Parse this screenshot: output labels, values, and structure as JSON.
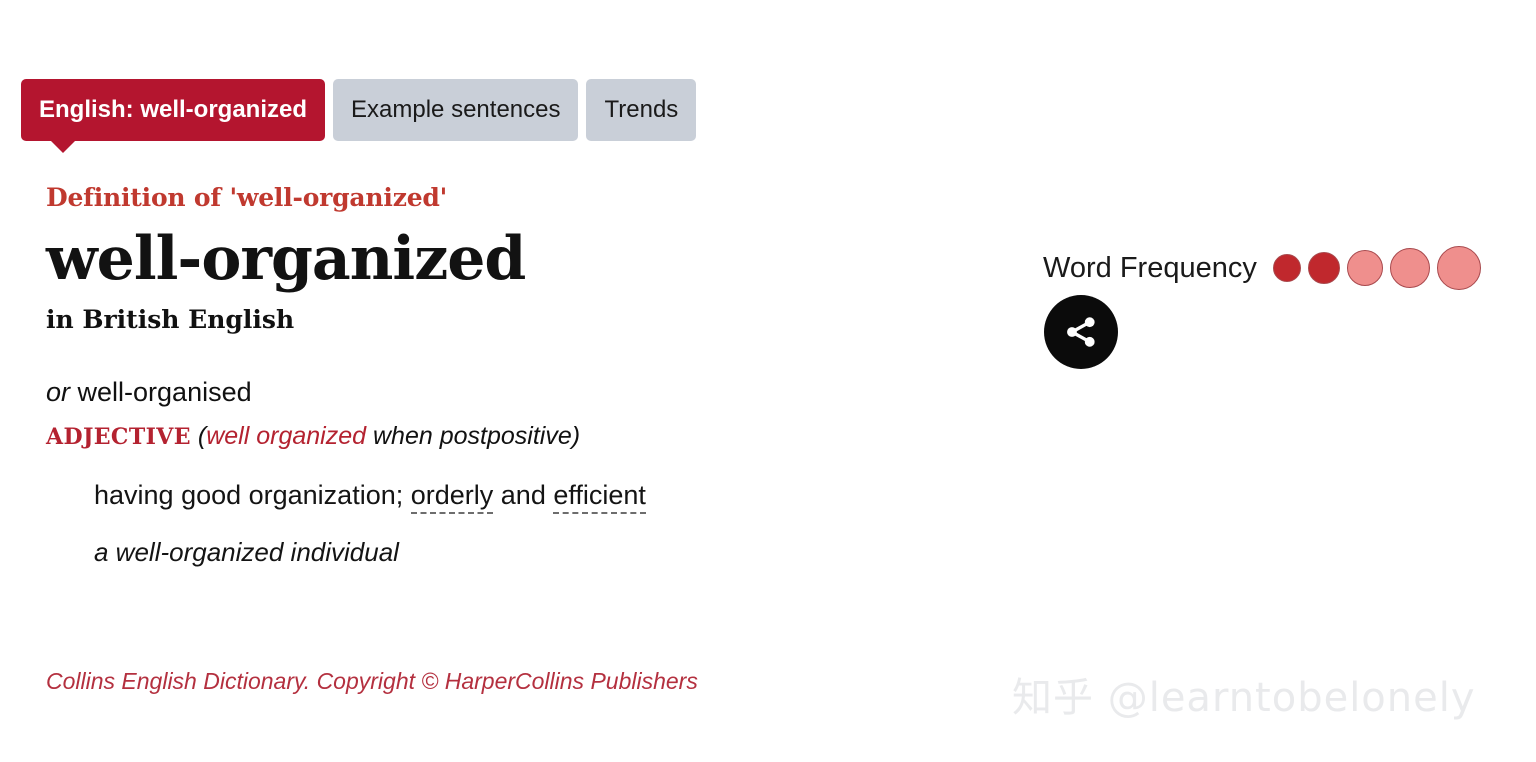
{
  "tabs": [
    {
      "label": "English: well-organized",
      "active": true
    },
    {
      "label": "Example sentences",
      "active": false
    },
    {
      "label": "Trends",
      "active": false
    }
  ],
  "definition": {
    "heading": "Definition of 'well-organized'",
    "headword": "well-organized",
    "language_label": "in British English",
    "variant_prefix": "or",
    "variant_word": "well-organised",
    "pos_tag": "ADJECTIVE",
    "pos_note_open": "(",
    "pos_note_red": "well organized",
    "pos_note_rest": " when postpositive",
    "pos_note_close": ")",
    "sense_text_before": "having good organization; ",
    "sense_link_1": "orderly",
    "sense_text_middle": " and ",
    "sense_link_2": "efficient",
    "example": "a well-organized individual",
    "copyright": "Collins English Dictionary. Copyright © HarperCollins Publishers"
  },
  "word_frequency": {
    "label": "Word Frequency",
    "rating": 2,
    "max": 5,
    "dots": [
      {
        "size": 28,
        "color": "#c0282d"
      },
      {
        "size": 32,
        "color": "#c0282d"
      },
      {
        "size": 36,
        "color": "#ef8f8d"
      },
      {
        "size": 40,
        "color": "#ef8f8d"
      },
      {
        "size": 44,
        "color": "#ef8f8d"
      }
    ]
  },
  "share": {
    "icon": "share-icon",
    "label": "Share"
  },
  "watermark": {
    "text": "知乎 @learntobelonely"
  },
  "colors": {
    "brand_red": "#b4152f",
    "heading_red": "#c0392f",
    "tab_gray": "#c9cfd8",
    "frequency_dark": "#c0282d",
    "frequency_light": "#ef8f8d"
  }
}
